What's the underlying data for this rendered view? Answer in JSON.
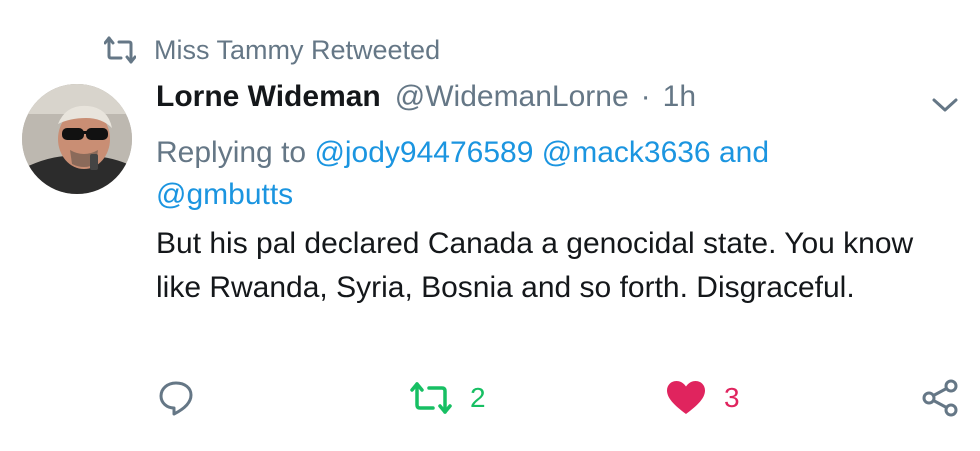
{
  "retweet_context": {
    "icon": "retweet-icon",
    "text": "Miss Tammy Retweeted"
  },
  "tweet": {
    "author": {
      "display_name": "Lorne Wideman",
      "handle": "@WidemanLorne",
      "separator": "·",
      "time": "1h"
    },
    "reply_context": {
      "prefix": "Replying to",
      "mention_1": "@jody94476589",
      "mention_2": "@mack3636",
      "joiner": "and",
      "mention_3": "@gmbutts"
    },
    "text": "But his pal declared Canada a genocidal state. You know like Rwanda, Syria, Bosnia and so forth. Disgraceful.",
    "actions": {
      "reply_icon": "reply-bubble-icon",
      "retweet_icon": "retweet-icon",
      "retweet_count": "2",
      "like_icon": "heart-icon",
      "like_count": "3",
      "share_icon": "share-icon"
    }
  },
  "colors": {
    "secondary_text": "#657786",
    "link": "#1b95e0",
    "retweet_green": "#17bf63",
    "like_red": "#e0245e",
    "primary_text": "#14171a"
  }
}
